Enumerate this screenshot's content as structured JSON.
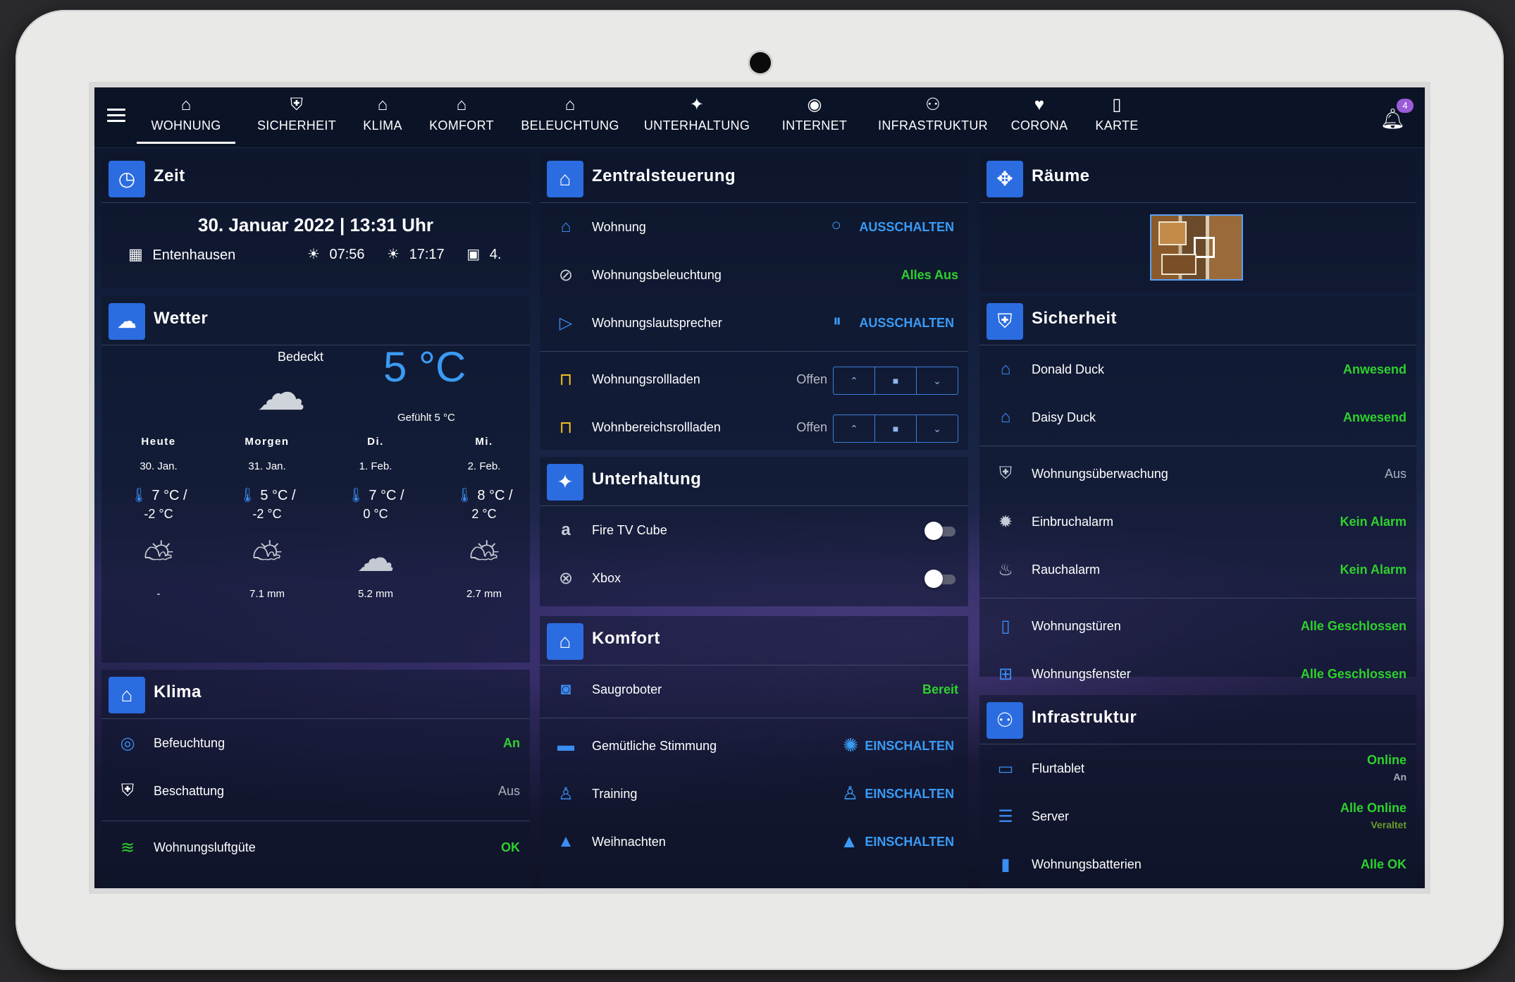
{
  "nav": {
    "tabs": [
      {
        "label": "WOHNUNG",
        "icon": "home-icon",
        "glyph": "⌂"
      },
      {
        "label": "SICHERHEIT",
        "icon": "shield-icon",
        "glyph": "⛨"
      },
      {
        "label": "KLIMA",
        "icon": "home-thermo-icon",
        "glyph": "⌂"
      },
      {
        "label": "KOMFORT",
        "icon": "home-heart-icon",
        "glyph": "⌂"
      },
      {
        "label": "BELEUCHTUNG",
        "icon": "home-lightbulb-icon",
        "glyph": "⌂"
      },
      {
        "label": "UNTERHALTUNG",
        "icon": "party-popper-icon",
        "glyph": "✦"
      },
      {
        "label": "INTERNET",
        "icon": "web-icon",
        "glyph": "◉"
      },
      {
        "label": "INFRASTRUKTUR",
        "icon": "network-icon",
        "glyph": "⚇"
      },
      {
        "label": "CORONA",
        "icon": "heart-pulse-icon",
        "glyph": "♥"
      },
      {
        "label": "KARTE",
        "icon": "map-icon",
        "glyph": "▯"
      }
    ],
    "notification_count": "4"
  },
  "zeit": {
    "title": "Zeit",
    "datetime": "30. Januar 2022 | 13:31 Uhr",
    "city": "Entenhausen",
    "sunrise": "07:56",
    "sunset": "17:17",
    "date_short": "4."
  },
  "wetter": {
    "title": "Wetter",
    "condition": "Bedeckt",
    "temp": "5 °C",
    "feels": "Gefühlt 5 °C",
    "days": [
      {
        "day": "Heute",
        "date": "30. Jan.",
        "high": "7 °C /",
        "low": "-2 °C",
        "precip": "-"
      },
      {
        "day": "Morgen",
        "date": "31. Jan.",
        "high": "5 °C /",
        "low": "-2 °C",
        "precip": "7.1 mm"
      },
      {
        "day": "Di.",
        "date": "1. Feb.",
        "high": "7 °C /",
        "low": "0 °C",
        "precip": "5.2 mm"
      },
      {
        "day": "Mi.",
        "date": "2. Feb.",
        "high": "8 °C /",
        "low": "2 °C",
        "precip": "2.7 mm"
      }
    ]
  },
  "klima": {
    "title": "Klima",
    "rows": [
      {
        "label": "Befeuchtung",
        "value": "An"
      },
      {
        "label": "Beschattung",
        "value": "Aus"
      },
      {
        "label": "Wohnungsluftgüte",
        "value": "OK"
      }
    ]
  },
  "zentral": {
    "title": "Zentralsteuerung",
    "wohnung": {
      "label": "Wohnung",
      "action": "AUSSCHALTEN"
    },
    "beleuchtung": {
      "label": "Wohnungsbeleuchtung",
      "value": "Alles Aus"
    },
    "lautsprecher": {
      "label": "Wohnungslautsprecher",
      "action": "AUSSCHALTEN"
    },
    "rollladen": {
      "label": "Wohnungsrollladen",
      "state": "Offen"
    },
    "bereich": {
      "label": "Wohnbereichsrollladen",
      "state": "Offen"
    },
    "shutter_up": "⌃",
    "shutter_stop": "■",
    "shutter_down": "⌄"
  },
  "unterhaltung": {
    "title": "Unterhaltung",
    "rows": [
      {
        "label": "Fire TV Cube"
      },
      {
        "label": "Xbox"
      }
    ]
  },
  "komfort": {
    "title": "Komfort",
    "saug": {
      "label": "Saugroboter",
      "value": "Bereit"
    },
    "rows": [
      {
        "label": "Gemütliche Stimmung",
        "action": "EINSCHALTEN"
      },
      {
        "label": "Training",
        "action": "EINSCHALTEN"
      },
      {
        "label": "Weihnachten",
        "action": "EINSCHALTEN"
      }
    ]
  },
  "raeume": {
    "title": "Räume"
  },
  "sicherheit": {
    "title": "Sicherheit",
    "rows": [
      {
        "label": "Donald Duck",
        "value": "Anwesend"
      },
      {
        "label": "Daisy Duck",
        "value": "Anwesend"
      },
      {
        "label": "Wohnungsüberwachung",
        "value": "Aus"
      },
      {
        "label": "Einbruchalarm",
        "value": "Kein Alarm"
      },
      {
        "label": "Rauchalarm",
        "value": "Kein Alarm"
      },
      {
        "label": "Wohnungstüren",
        "value": "Alle Geschlossen"
      },
      {
        "label": "Wohnungsfenster",
        "value": "Alle Geschlossen"
      }
    ]
  },
  "infra": {
    "title": "Infrastruktur",
    "rows": [
      {
        "label": "Flurtablet",
        "value": "Online",
        "sub": "An"
      },
      {
        "label": "Server",
        "value": "Alle Online",
        "sub": "Veraltet"
      },
      {
        "label": "Wohnungsbatterien",
        "value": "Alle OK"
      }
    ]
  },
  "colors": {
    "accent": "#2b6ce0",
    "ok": "#2ed12e",
    "link": "#3a9bf5",
    "background": "#0b1428"
  }
}
